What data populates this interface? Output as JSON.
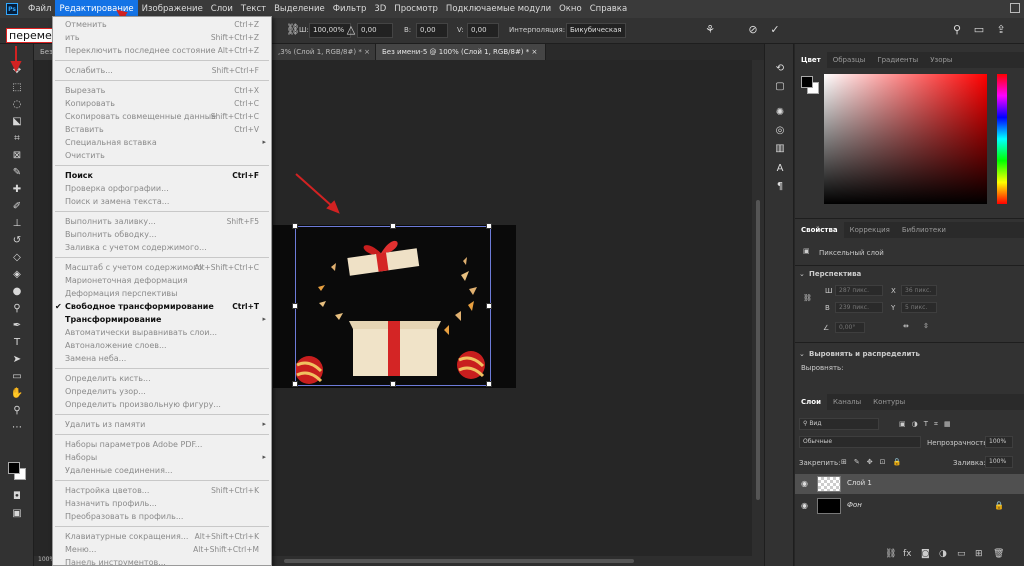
{
  "app": {
    "logo_text": "Ps"
  },
  "menubar": {
    "items": [
      "Файл",
      "Редактирование",
      "Изображение",
      "Слои",
      "Текст",
      "Выделение",
      "Фильтр",
      "3D",
      "Просмотр",
      "Подключаемые модули",
      "Окно",
      "Справка"
    ],
    "active_index": 1
  },
  "options": {
    "w_label": "Ш:",
    "w_value": "100,00%",
    "angle_value": "0,00",
    "b_label": "В:",
    "b_value": "0,00",
    "v_label": "V:",
    "v_value": "0,00",
    "interp_label": "Интерполяция:",
    "interp_value": "Бикубическая"
  },
  "tabs": [
    {
      "label": "Без",
      "active": false
    },
    {
      "label": ",3% (Слой 1, RGB/8#) *",
      "active": false
    },
    {
      "label": "Без имени-5 @ 100% (Слой 1, RGB/8#) *",
      "active": true
    }
  ],
  "annotation": "перемещение",
  "zoom_readout": "100%",
  "edit_menu": [
    {
      "label": "Отменить",
      "shortcut": "Ctrl+Z",
      "enabled": false
    },
    {
      "label": "ить",
      "shortcut": "Shift+Ctrl+Z",
      "enabled": false
    },
    {
      "label": "Переключить последнее состояние",
      "shortcut": "Alt+Ctrl+Z",
      "enabled": false
    },
    {
      "sep": true
    },
    {
      "label": "Ослабить...",
      "shortcut": "Shift+Ctrl+F",
      "enabled": false
    },
    {
      "sep": true
    },
    {
      "label": "Вырезать",
      "shortcut": "Ctrl+X",
      "enabled": false
    },
    {
      "label": "Копировать",
      "shortcut": "Ctrl+C",
      "enabled": false
    },
    {
      "label": "Скопировать совмещенные данные",
      "shortcut": "Shift+Ctrl+C",
      "enabled": false
    },
    {
      "label": "Вставить",
      "shortcut": "Ctrl+V",
      "enabled": false
    },
    {
      "label": "Специальная вставка",
      "shortcut": "",
      "enabled": false,
      "submenu": true
    },
    {
      "label": "Очистить",
      "shortcut": "",
      "enabled": false
    },
    {
      "sep": true
    },
    {
      "label": "Поиск",
      "shortcut": "Ctrl+F",
      "enabled": true
    },
    {
      "label": "Проверка орфографии...",
      "shortcut": "",
      "enabled": false
    },
    {
      "label": "Поиск и замена текста...",
      "shortcut": "",
      "enabled": false
    },
    {
      "sep": true
    },
    {
      "label": "Выполнить заливку...",
      "shortcut": "Shift+F5",
      "enabled": false
    },
    {
      "label": "Выполнить обводку...",
      "shortcut": "",
      "enabled": false
    },
    {
      "label": "Заливка с учетом содержимого...",
      "shortcut": "",
      "enabled": false
    },
    {
      "sep": true
    },
    {
      "label": "Масштаб с учетом содержимого",
      "shortcut": "Alt+Shift+Ctrl+C",
      "enabled": false
    },
    {
      "label": "Марионеточная деформация",
      "shortcut": "",
      "enabled": false
    },
    {
      "label": "Деформация перспективы",
      "shortcut": "",
      "enabled": false
    },
    {
      "label": "Свободное трансформирование",
      "shortcut": "Ctrl+T",
      "enabled": true,
      "checked": true
    },
    {
      "label": "Трансформирование",
      "shortcut": "",
      "enabled": true,
      "submenu": true
    },
    {
      "label": "Автоматически выравнивать слои...",
      "shortcut": "",
      "enabled": false
    },
    {
      "label": "Автоналожение слоев...",
      "shortcut": "",
      "enabled": false
    },
    {
      "label": "Замена неба...",
      "shortcut": "",
      "enabled": false
    },
    {
      "sep": true
    },
    {
      "label": "Определить кисть...",
      "shortcut": "",
      "enabled": false
    },
    {
      "label": "Определить узор...",
      "shortcut": "",
      "enabled": false
    },
    {
      "label": "Определить произвольную фигуру...",
      "shortcut": "",
      "enabled": false
    },
    {
      "sep": true
    },
    {
      "label": "Удалить из памяти",
      "shortcut": "",
      "enabled": false,
      "submenu": true
    },
    {
      "sep": true
    },
    {
      "label": "Наборы параметров Adobe PDF...",
      "shortcut": "",
      "enabled": false
    },
    {
      "label": "Наборы",
      "shortcut": "",
      "enabled": false,
      "submenu": true
    },
    {
      "label": "Удаленные соединения...",
      "shortcut": "",
      "enabled": false
    },
    {
      "sep": true
    },
    {
      "label": "Настройка цветов...",
      "shortcut": "Shift+Ctrl+K",
      "enabled": false
    },
    {
      "label": "Назначить профиль...",
      "shortcut": "",
      "enabled": false
    },
    {
      "label": "Преобразовать в профиль...",
      "shortcut": "",
      "enabled": false
    },
    {
      "sep": true
    },
    {
      "label": "Клавиатурные сокращения...",
      "shortcut": "Alt+Shift+Ctrl+K",
      "enabled": false
    },
    {
      "label": "Меню...",
      "shortcut": "Alt+Shift+Ctrl+M",
      "enabled": false
    },
    {
      "label": "Панель инструментов...",
      "shortcut": "",
      "enabled": false
    }
  ],
  "color_panel": {
    "tabs": [
      "Цвет",
      "Образцы",
      "Градиенты",
      "Узоры"
    ],
    "active_index": 0
  },
  "properties_panel": {
    "tabs": [
      "Свойства",
      "Коррекция",
      "Библиотеки"
    ],
    "active_index": 0,
    "layer_type": "Пиксельный слой",
    "section_perspective": "Перспектива",
    "w_label": "Ш",
    "w_value": "287 пикс.",
    "x_label": "X",
    "x_value": "36 пикс.",
    "h_label": "В",
    "h_value": "239 пикс.",
    "y_label": "Y",
    "y_value": "5 пикс.",
    "angle_value": "0,00°",
    "section_align": "Выровнять и распределить",
    "align_label": "Выровнять:"
  },
  "layers_panel": {
    "tabs": [
      "Слои",
      "Каналы",
      "Контуры"
    ],
    "active_index": 0,
    "filter_value": "Вид",
    "blend_mode": "Обычные",
    "opacity_label": "Непрозрачность:",
    "opacity_value": "100%",
    "lock_label": "Закрепить:",
    "fill_label": "Заливка:",
    "fill_value": "100%",
    "layers": [
      {
        "name": "Слой 1",
        "selected": true
      },
      {
        "name": "Фон",
        "selected": false,
        "locked": true
      }
    ]
  },
  "colors": {
    "accent": "#1473e6",
    "bbox": "#6d7bd8",
    "annotation_red": "#d22222"
  }
}
